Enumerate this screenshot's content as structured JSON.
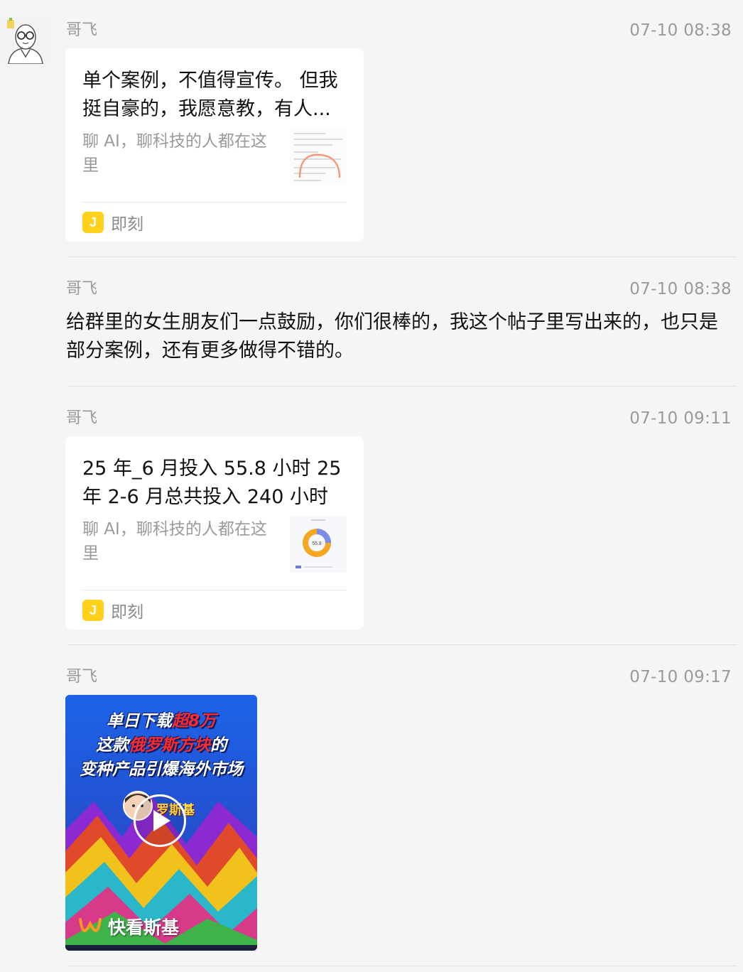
{
  "messages": [
    {
      "sender": "哥飞",
      "time": "07-10 08:38",
      "card": {
        "title": "单个案例，不值得宣传。 但我挺自豪的，我愿意教，有人...",
        "description": "聊 AI，聊科技的人都在这里",
        "source": "即刻",
        "source_icon_letter": "J",
        "source_icon": "jike-logo-icon",
        "thumb_icon": "article-thumbnail-icon"
      }
    },
    {
      "sender": "哥飞",
      "time": "07-10 08:38",
      "text": "给群里的女生朋友们一点鼓励，你们很棒的，我这个帖子里写出来的，也只是部分案例，还有更多做得不错的。"
    },
    {
      "sender": "哥飞",
      "time": "07-10 09:11",
      "card": {
        "title": "25 年_6 月投入 55.8 小时 25 年 2-6 月总共投入 240 小时 ...",
        "description": "聊 AI，聊科技的人都在这里",
        "source": "即刻",
        "source_icon_letter": "J",
        "source_icon": "jike-logo-icon",
        "thumb_icon": "donut-chart-thumbnail-icon"
      }
    },
    {
      "sender": "哥飞",
      "time": "07-10 09:17",
      "video": {
        "headline_line1_a": "单日下载",
        "headline_line1_b": "超8万",
        "headline_line2_a": "这款",
        "headline_line2_b": "俄罗斯方块",
        "headline_line2_c": "的",
        "headline_line3": "变种产品引爆海外市场",
        "overlay_name": "罗斯基",
        "brand": "快看斯基",
        "play_icon": "play-icon"
      }
    }
  ],
  "colors": {
    "background": "#f5f5f5",
    "card": "#ffffff",
    "meta_text": "#9a9a9a",
    "jike_yellow": "#ffd11a",
    "video_blue": "#1b4fd6",
    "highlight_red": "#ff2a2a"
  }
}
